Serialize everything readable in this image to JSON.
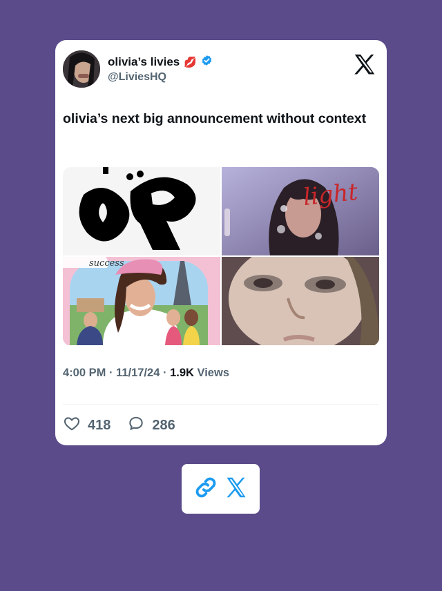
{
  "tweet": {
    "display_name": "olivia’s livies",
    "name_emoji": "💋",
    "handle": "@LiviesHQ",
    "text": "olivia’s next big announcement without context",
    "time": "4:00 PM",
    "date": "11/17/24",
    "views_count": "1.9K",
    "views_label": "Views",
    "separator": "·",
    "likes": "418",
    "replies": "286"
  },
  "media": {
    "image2_text": "light",
    "image3_text": "success"
  },
  "colors": {
    "background": "#5b4b8a",
    "card": "#ffffff",
    "verified": "#1d9bf0",
    "link_icon": "#1d9bf0"
  },
  "icons": {
    "platform": "x-logo-icon",
    "verified": "verified-badge-icon",
    "like": "heart-icon",
    "reply": "comment-icon",
    "link": "link-icon"
  }
}
